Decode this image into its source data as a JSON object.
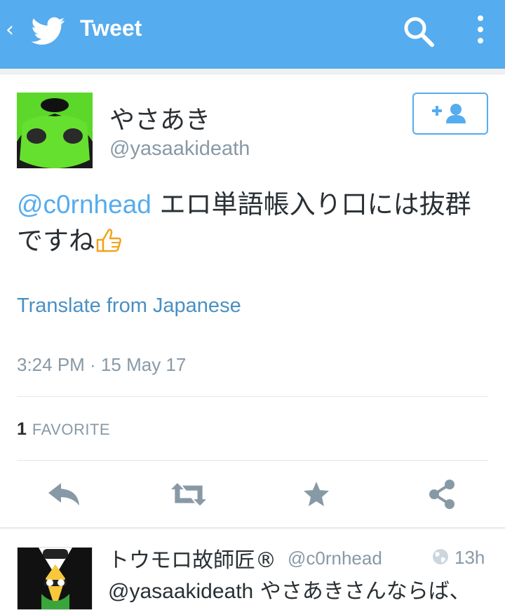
{
  "header": {
    "title": "Tweet",
    "background": "#55acee",
    "icons": [
      "back-chevron-icon",
      "twitter-bird-icon",
      "search-icon",
      "overflow-menu-icon"
    ]
  },
  "tweet": {
    "author_name": "やさあき",
    "author_handle": "@yasaakideath",
    "mention": "@c0rnhead",
    "text": "エロ単語帳入り口には抜群ですね",
    "emoji": "thumbs-up",
    "translate_label": "Translate from Japanese",
    "timestamp": "3:24 PM · 15 May 17",
    "favorite_count": "1",
    "favorite_label": "FAVORITE"
  },
  "actions": [
    "reply-icon",
    "retweet-icon",
    "favorite-star-icon",
    "share-icon"
  ],
  "reply": {
    "author_name": "トウモロ故師匠®",
    "author_handle": "@c0rnhead",
    "time": "13h",
    "mention": "@yasaakideath",
    "text": "やさあきさんならば、"
  },
  "colors": {
    "accent": "#55acee",
    "link": "#4a90c2",
    "text": "#292f33",
    "muted": "#8899a6",
    "action_icon": "#8899a6"
  }
}
